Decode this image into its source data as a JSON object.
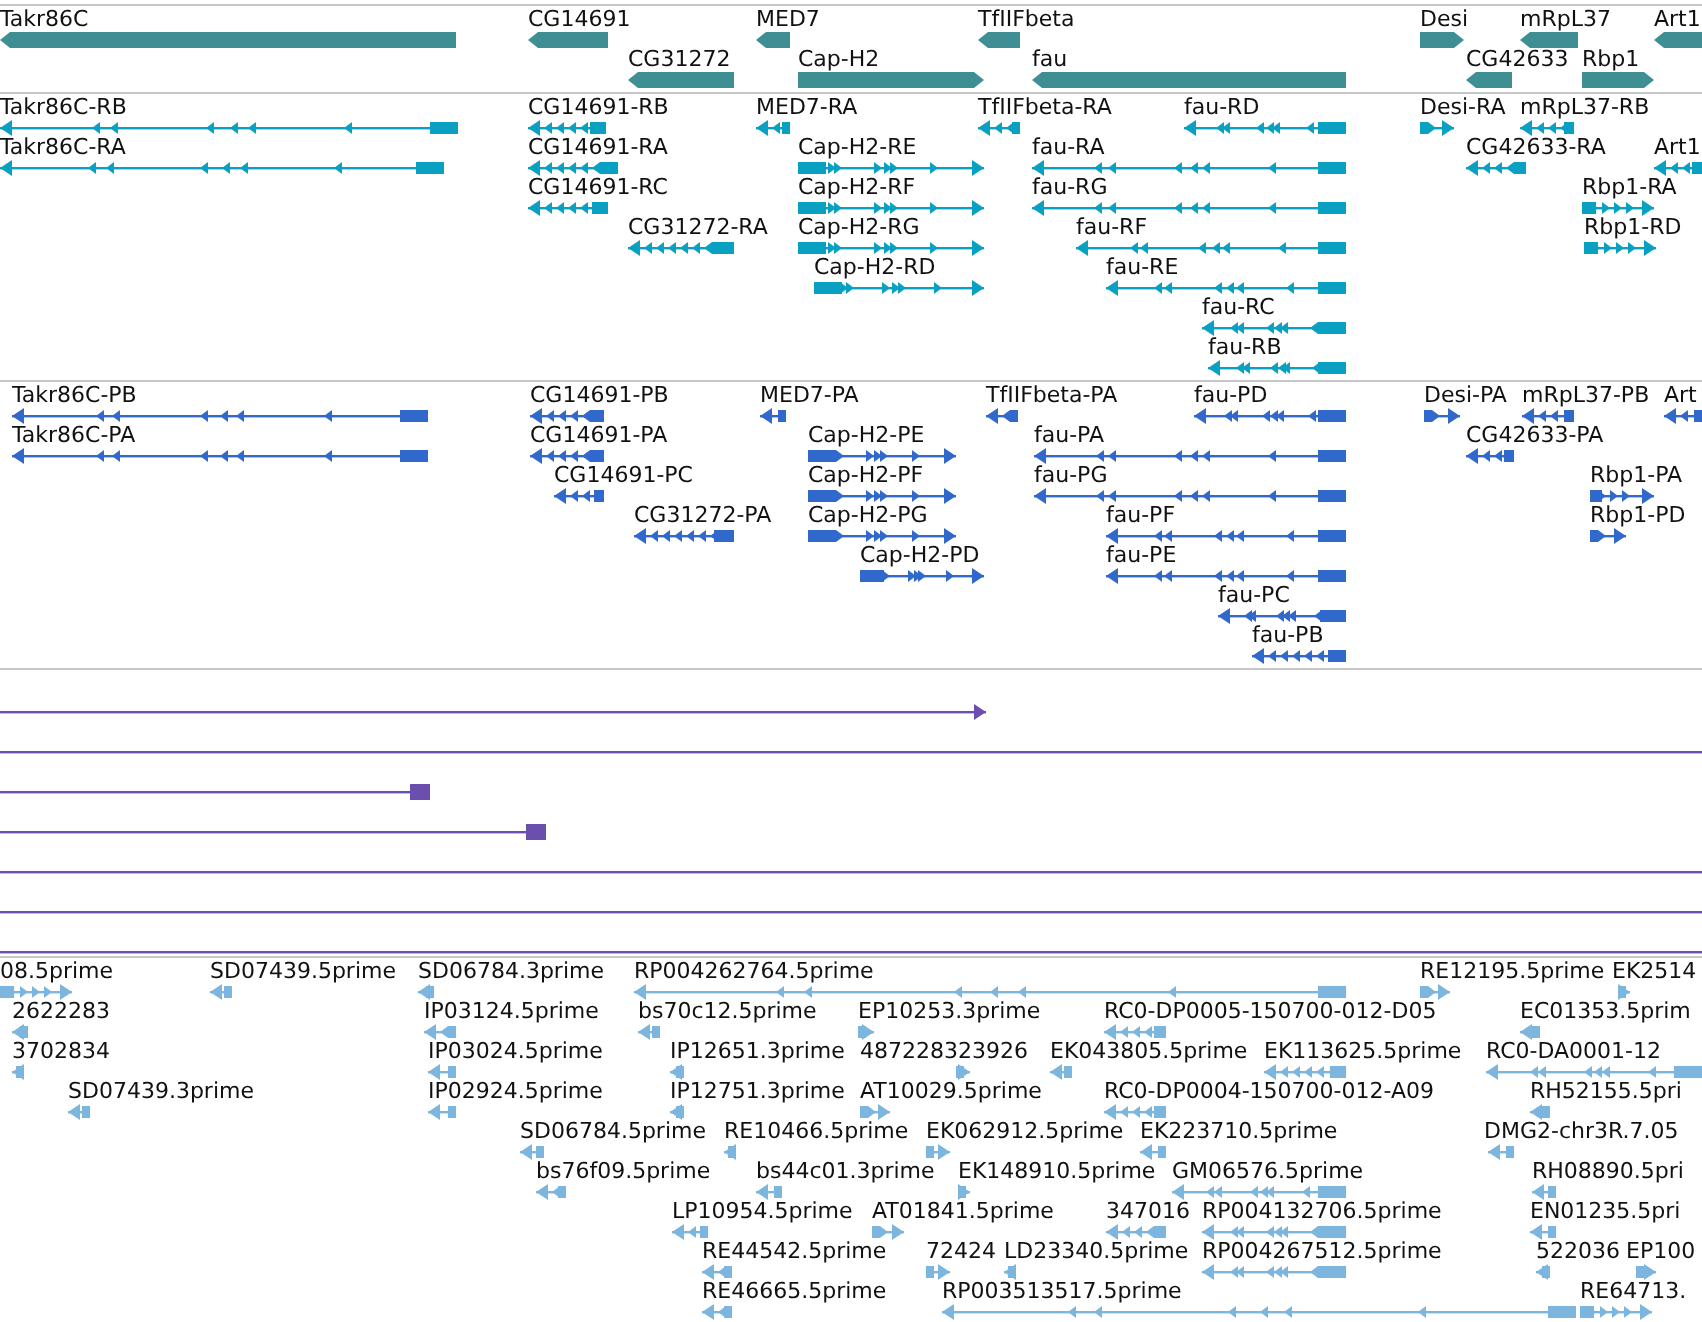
{
  "tracks": [
    {
      "kind": "gene",
      "color": "#3d8f94",
      "features": [
        {
          "label": "Takr86C",
          "reverse": true
        },
        {
          "label": "CG14691",
          "reverse": true
        },
        {
          "label": "MED7",
          "reverse": true
        },
        {
          "label": "TfIIFbeta",
          "reverse": true
        },
        {
          "label": "Desi",
          "reverse": false
        },
        {
          "label": "mRpL37",
          "reverse": true
        },
        {
          "label": "Art1",
          "reverse": true
        },
        {
          "label": "CG31272",
          "reverse": true
        },
        {
          "label": "Cap-H2",
          "reverse": false
        },
        {
          "label": "fau",
          "reverse": true
        },
        {
          "label": "CG42633",
          "reverse": true
        },
        {
          "label": "Rbp1",
          "reverse": false
        }
      ]
    },
    {
      "kind": "transcript",
      "color": "#0aa0c2",
      "features": [
        {
          "label": "Takr86C-RB",
          "reverse": true
        },
        {
          "label": "CG14691-RB",
          "reverse": true
        },
        {
          "label": "MED7-RA",
          "reverse": true
        },
        {
          "label": "TfIIFbeta-RA",
          "reverse": true
        },
        {
          "label": "fau-RD",
          "reverse": true
        },
        {
          "label": "Desi-RA",
          "reverse": false
        },
        {
          "label": "mRpL37-RB",
          "reverse": true
        },
        {
          "label": "Takr86C-RA",
          "reverse": true
        },
        {
          "label": "CG14691-RA",
          "reverse": true
        },
        {
          "label": "Cap-H2-RE",
          "reverse": false
        },
        {
          "label": "fau-RA",
          "reverse": true
        },
        {
          "label": "CG42633-RA",
          "reverse": true
        },
        {
          "label": "Art1",
          "reverse": true
        },
        {
          "label": "CG14691-RC",
          "reverse": true
        },
        {
          "label": "Cap-H2-RF",
          "reverse": false
        },
        {
          "label": "fau-RG",
          "reverse": true
        },
        {
          "label": "Rbp1-RA",
          "reverse": false
        },
        {
          "label": "CG31272-RA",
          "reverse": true
        },
        {
          "label": "Cap-H2-RG",
          "reverse": false
        },
        {
          "label": "fau-RF",
          "reverse": true
        },
        {
          "label": "Rbp1-RD",
          "reverse": false
        },
        {
          "label": "Cap-H2-RD",
          "reverse": false
        },
        {
          "label": "fau-RE",
          "reverse": true
        },
        {
          "label": "fau-RC",
          "reverse": true
        },
        {
          "label": "fau-RB",
          "reverse": true
        }
      ]
    },
    {
      "kind": "protein",
      "color": "#3068cc",
      "features": [
        {
          "label": "Takr86C-PB",
          "reverse": true
        },
        {
          "label": "CG14691-PB",
          "reverse": true
        },
        {
          "label": "MED7-PA",
          "reverse": true
        },
        {
          "label": "TfIIFbeta-PA",
          "reverse": true
        },
        {
          "label": "fau-PD",
          "reverse": true
        },
        {
          "label": "Desi-PA",
          "reverse": false
        },
        {
          "label": "mRpL37-PB",
          "reverse": true
        },
        {
          "label": "Art",
          "reverse": true
        },
        {
          "label": "Takr86C-PA",
          "reverse": true
        },
        {
          "label": "CG14691-PA",
          "reverse": true
        },
        {
          "label": "Cap-H2-PE",
          "reverse": false
        },
        {
          "label": "fau-PA",
          "reverse": true
        },
        {
          "label": "CG42633-PA",
          "reverse": true
        },
        {
          "label": "CG14691-PC",
          "reverse": true
        },
        {
          "label": "Cap-H2-PF",
          "reverse": false
        },
        {
          "label": "fau-PG",
          "reverse": true
        },
        {
          "label": "Rbp1-PA",
          "reverse": false
        },
        {
          "label": "CG31272-PA",
          "reverse": true
        },
        {
          "label": "Cap-H2-PG",
          "reverse": false
        },
        {
          "label": "fau-PF",
          "reverse": true
        },
        {
          "label": "Rbp1-PD",
          "reverse": false
        },
        {
          "label": "Cap-H2-PD",
          "reverse": false
        },
        {
          "label": "fau-PE",
          "reverse": true
        },
        {
          "label": "fau-PC",
          "reverse": true
        },
        {
          "label": "fau-PB",
          "reverse": true
        }
      ]
    },
    {
      "kind": "alignment",
      "color": "#6b4fae",
      "features": [
        {
          "kind": "arrow"
        },
        {
          "kind": "line"
        },
        {
          "kind": "block"
        },
        {
          "kind": "block"
        },
        {
          "kind": "line"
        },
        {
          "kind": "line"
        },
        {
          "kind": "line"
        }
      ]
    },
    {
      "kind": "est",
      "color": "#7cb5dd",
      "features": [
        {
          "label": "08.5prime",
          "reverse": false
        },
        {
          "label": "SD07439.5prime",
          "reverse": true
        },
        {
          "label": "SD06784.3prime",
          "reverse": true
        },
        {
          "label": "RP004262764.5prime",
          "reverse": true
        },
        {
          "label": "RE12195.5prime",
          "reverse": false
        },
        {
          "label": "EK2514",
          "reverse": false
        },
        {
          "label": "2622283",
          "reverse": true
        },
        {
          "label": "IP03124.5prime",
          "reverse": true
        },
        {
          "label": "bs70c12.5prime",
          "reverse": true
        },
        {
          "label": "EP10253.3prime",
          "reverse": false
        },
        {
          "label": "RC0-DP0005-150700-012-D05",
          "reverse": true
        },
        {
          "label": "EC01353.5prim",
          "reverse": true
        },
        {
          "label": "3702834",
          "reverse": true
        },
        {
          "label": "IP03024.5prime",
          "reverse": true
        },
        {
          "label": "IP12651.3prime",
          "reverse": true
        },
        {
          "label": "487228323926",
          "reverse": false
        },
        {
          "label": "EK043805.5prime",
          "reverse": true
        },
        {
          "label": "EK113625.5prime",
          "reverse": true
        },
        {
          "label": "RC0-DA0001-12",
          "reverse": true
        },
        {
          "label": "SD07439.3prime",
          "reverse": true
        },
        {
          "label": "IP02924.5prime",
          "reverse": true
        },
        {
          "label": "IP12751.3prime",
          "reverse": true
        },
        {
          "label": "AT10029.5prime",
          "reverse": false
        },
        {
          "label": "RC0-DP0004-150700-012-A09",
          "reverse": true
        },
        {
          "label": "RH52155.5pri",
          "reverse": true
        },
        {
          "label": "SD06784.5prime",
          "reverse": true
        },
        {
          "label": "RE10466.5prime",
          "reverse": true
        },
        {
          "label": "EK062912.5prime",
          "reverse": false
        },
        {
          "label": "EK223710.5prime",
          "reverse": true
        },
        {
          "label": "DMG2-chr3R.7.05",
          "reverse": true
        },
        {
          "label": "bs76f09.5prime",
          "reverse": true
        },
        {
          "label": "bs44c01.3prime",
          "reverse": true
        },
        {
          "label": "EK148910.5prime",
          "reverse": false
        },
        {
          "label": "GM06576.5prime",
          "reverse": true
        },
        {
          "label": "RH08890.5pri",
          "reverse": true
        },
        {
          "label": "LP10954.5prime",
          "reverse": true
        },
        {
          "label": "AT01841.5prime",
          "reverse": false
        },
        {
          "label": "347016",
          "reverse": true
        },
        {
          "label": "RP004132706.5prime",
          "reverse": true
        },
        {
          "label": "EN01235.5pri",
          "reverse": true
        },
        {
          "label": "RE44542.5prime",
          "reverse": true
        },
        {
          "label": "72424",
          "reverse": false
        },
        {
          "label": "LD23340.5prime",
          "reverse": true
        },
        {
          "label": "RP004267512.5prime",
          "reverse": true
        },
        {
          "label": "522036",
          "reverse": true
        },
        {
          "label": "EP100",
          "reverse": false
        },
        {
          "label": "RE46665.5prime",
          "reverse": true
        },
        {
          "label": "RP003513517.5prime",
          "reverse": true
        },
        {
          "label": "RE64713.",
          "reverse": false
        }
      ]
    }
  ]
}
